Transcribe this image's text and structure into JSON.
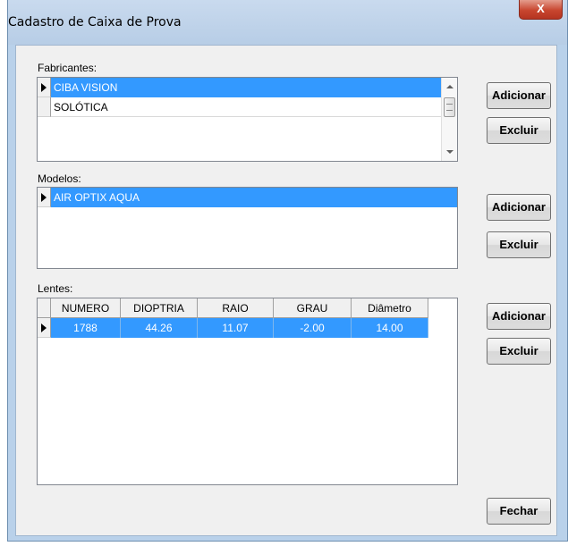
{
  "window": {
    "title": "Cadastro de Caixa de Prova",
    "close_label": "X"
  },
  "fabricantes": {
    "label": "Fabricantes:",
    "items": [
      "CIBA VISION",
      "SOLÓTICA"
    ],
    "add_label": "Adicionar",
    "remove_label": "Excluir"
  },
  "modelos": {
    "label": "Modelos:",
    "items": [
      "AIR OPTIX AQUA"
    ],
    "add_label": "Adicionar",
    "remove_label": "Excluir"
  },
  "lentes": {
    "label": "Lentes:",
    "columns": [
      "NUMERO",
      "DIOPTRIA",
      "RAIO",
      "GRAU",
      "Diâmetro"
    ],
    "rows": [
      [
        "1788",
        "44.26",
        "11.07",
        "-2.00",
        "14.00"
      ]
    ],
    "add_label": "Adicionar",
    "remove_label": "Excluir"
  },
  "footer": {
    "close_label": "Fechar"
  },
  "colors": {
    "selection": "#3399ff",
    "frame": "#b9d1ea"
  }
}
